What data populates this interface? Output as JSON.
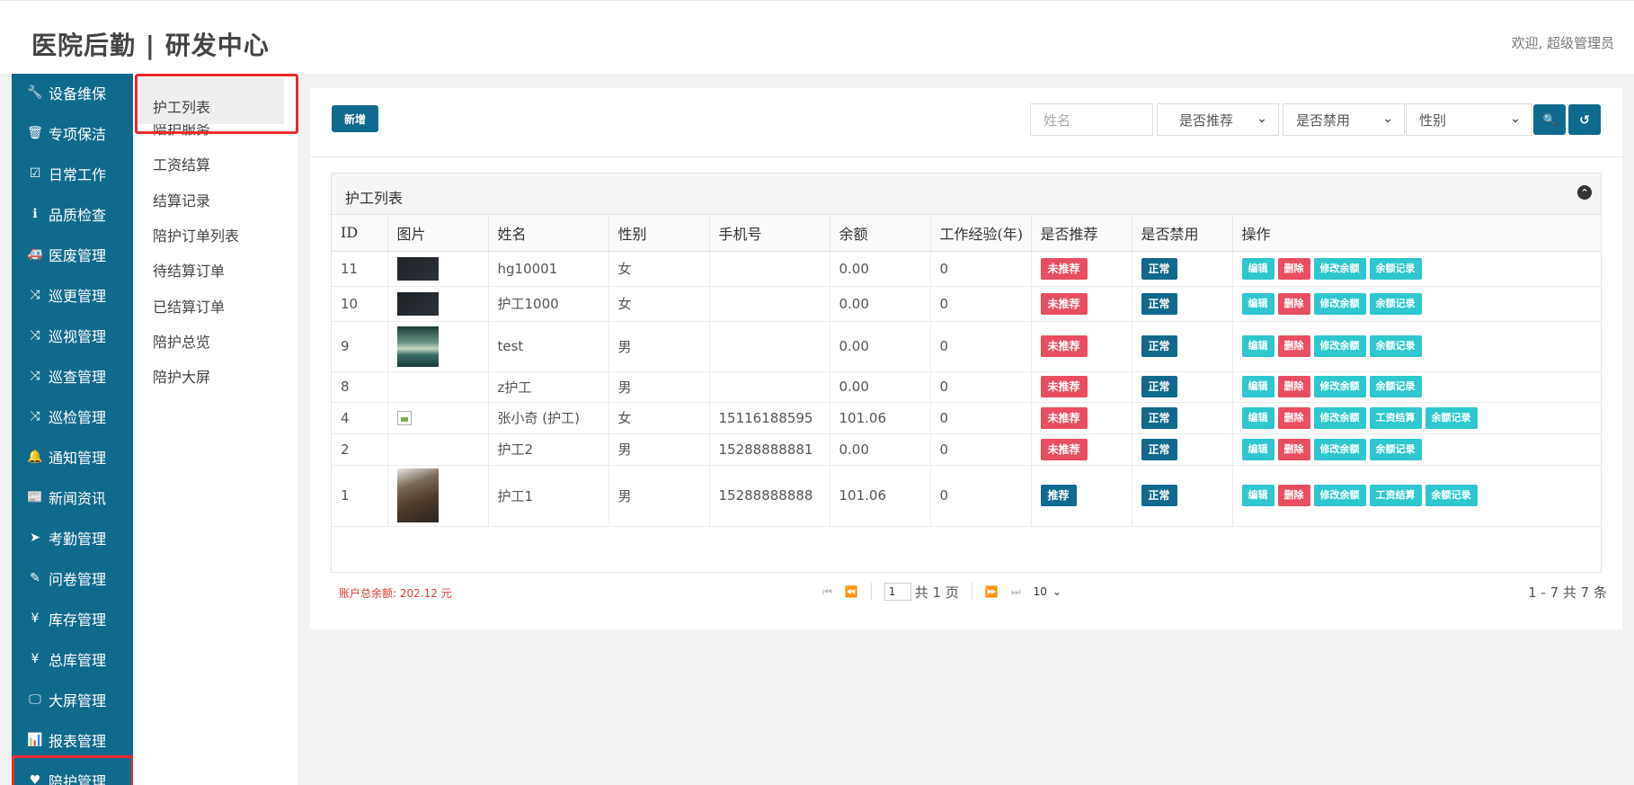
{
  "header": {
    "brand": "医院后勤 | 研发中心",
    "welcome": "欢迎, 超级管理员"
  },
  "sidebar": {
    "items": [
      {
        "label": "设备维保",
        "icon": "wrench-icon",
        "glyph": "🔧"
      },
      {
        "label": "专项保洁",
        "icon": "trash-icon",
        "glyph": "🗑"
      },
      {
        "label": "日常工作",
        "icon": "check-square-icon",
        "glyph": "☑"
      },
      {
        "label": "品质检查",
        "icon": "info-circle-icon",
        "glyph": "ℹ"
      },
      {
        "label": "医废管理",
        "icon": "ambulance-icon",
        "glyph": "🚑"
      },
      {
        "label": "巡更管理",
        "icon": "random-icon",
        "glyph": "⤨"
      },
      {
        "label": "巡视管理",
        "icon": "random-icon",
        "glyph": "⤨"
      },
      {
        "label": "巡查管理",
        "icon": "random-icon",
        "glyph": "⤨"
      },
      {
        "label": "巡检管理",
        "icon": "random-icon",
        "glyph": "⤨"
      },
      {
        "label": "通知管理",
        "icon": "bell-icon",
        "glyph": "🔔"
      },
      {
        "label": "新闻资讯",
        "icon": "newspaper-icon",
        "glyph": "📰"
      },
      {
        "label": "考勤管理",
        "icon": "send-icon",
        "glyph": "➤"
      },
      {
        "label": "问卷管理",
        "icon": "edit-icon",
        "glyph": "✎"
      },
      {
        "label": "库存管理",
        "icon": "yen-icon",
        "glyph": "¥"
      },
      {
        "label": "总库管理",
        "icon": "yen-icon",
        "glyph": "¥"
      },
      {
        "label": "大屏管理",
        "icon": "monitor-icon",
        "glyph": "🖵"
      },
      {
        "label": "报表管理",
        "icon": "bar-chart-icon",
        "glyph": "📊"
      },
      {
        "label": "陪护管理",
        "icon": "heartbeat-icon",
        "glyph": "♥"
      }
    ]
  },
  "submenu": {
    "items": [
      "护工列表",
      "陪护服务",
      "工资结算",
      "结算记录",
      "陪护订单列表",
      "待结算订单",
      "已结算订单",
      "陪护总览",
      "陪护大屏"
    ]
  },
  "toolbar": {
    "add_label": "新增",
    "name_placeholder": "姓名",
    "recommend_select": "是否推荐",
    "disabled_select": "是否禁用",
    "gender_select": "性别",
    "search_glyph": "🔍",
    "reset_glyph": "↺"
  },
  "panel": {
    "title": "护工列表"
  },
  "table": {
    "headers": [
      "ID",
      "图片",
      "姓名",
      "性别",
      "手机号",
      "余额",
      "工作经验(年)",
      "是否推荐",
      "是否禁用",
      "操作"
    ],
    "rows": [
      {
        "id": "11",
        "image": "dark",
        "name": "hg10001",
        "gender": "女",
        "phone": "",
        "balance": "0.00",
        "exp": "0",
        "recommend": "未推荐",
        "disabled": "正常",
        "ops": [
          "编辑",
          "删除",
          "修改余额",
          "余额记录"
        ]
      },
      {
        "id": "10",
        "image": "dark",
        "name": "护工1000",
        "gender": "女",
        "phone": "",
        "balance": "0.00",
        "exp": "0",
        "recommend": "未推荐",
        "disabled": "正常",
        "ops": [
          "编辑",
          "删除",
          "修改余额",
          "余额记录"
        ]
      },
      {
        "id": "9",
        "image": "sea",
        "name": "test",
        "gender": "男",
        "phone": "",
        "balance": "0.00",
        "exp": "0",
        "recommend": "未推荐",
        "disabled": "正常",
        "ops": [
          "编辑",
          "删除",
          "修改余额",
          "余额记录"
        ]
      },
      {
        "id": "8",
        "image": "",
        "name": "z护工",
        "gender": "男",
        "phone": "",
        "balance": "0.00",
        "exp": "0",
        "recommend": "未推荐",
        "disabled": "正常",
        "ops": [
          "编辑",
          "删除",
          "修改余额",
          "余额记录"
        ]
      },
      {
        "id": "4",
        "image": "broken",
        "name": "张小奇 (护工)",
        "gender": "女",
        "phone": "15116188595",
        "balance": "101.06",
        "exp": "0",
        "recommend": "未推荐",
        "disabled": "正常",
        "ops": [
          "编辑",
          "删除",
          "修改余额",
          "工资结算",
          "余额记录"
        ]
      },
      {
        "id": "2",
        "image": "",
        "name": "护工2",
        "gender": "男",
        "phone": "15288888881",
        "balance": "0.00",
        "exp": "0",
        "recommend": "未推荐",
        "disabled": "正常",
        "ops": [
          "编辑",
          "删除",
          "修改余额",
          "余额记录"
        ]
      },
      {
        "id": "1",
        "image": "photo",
        "name": "护工1",
        "gender": "男",
        "phone": "15288888888",
        "balance": "101.06",
        "exp": "0",
        "recommend": "推荐",
        "disabled": "正常",
        "ops": [
          "编辑",
          "删除",
          "修改余额",
          "工资结算",
          "余额记录"
        ]
      }
    ]
  },
  "footer": {
    "total": "账户总余额: 202.12 元",
    "page_input": "1",
    "page_total": "共 1 页",
    "page_size": "10",
    "range": "1 - 7   共 7 条"
  },
  "colors": {
    "primary": "#106a8e",
    "danger": "#e84e5f",
    "info": "#2ec7cf",
    "highlight_border": "#ee2a2a"
  }
}
